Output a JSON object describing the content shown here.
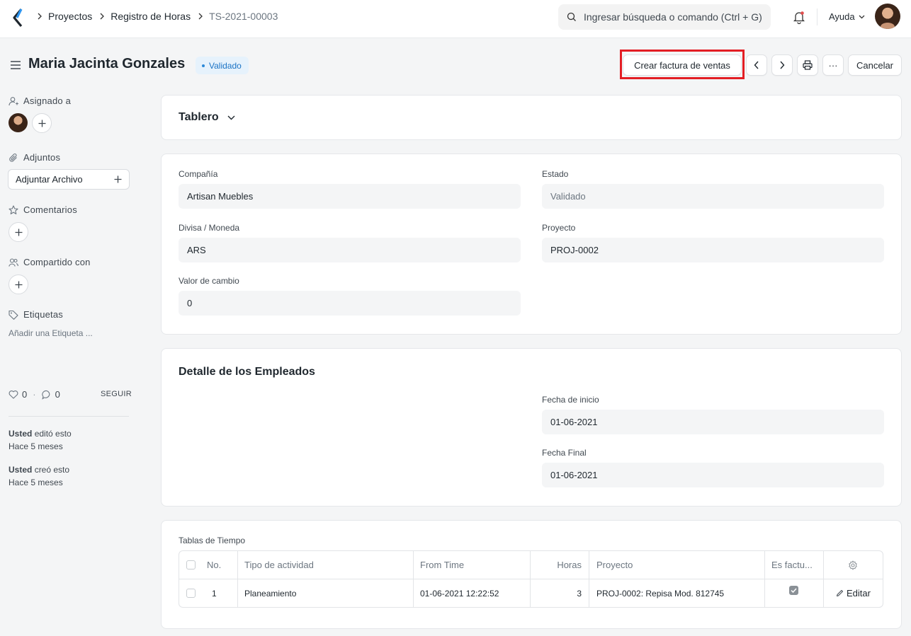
{
  "navbar": {
    "breadcrumbs": [
      "Proyectos",
      "Registro de Horas",
      "TS-2021-00003"
    ],
    "search_placeholder": "Ingresar búsqueda o comando (Ctrl + G)",
    "help_label": "Ayuda"
  },
  "header": {
    "title": "Maria Jacinta Gonzales",
    "status": "Validado",
    "create_invoice_label": "Crear factura de ventas",
    "more_label": "···",
    "cancel_label": "Cancelar"
  },
  "sidebar": {
    "assigned_label": "Asignado a",
    "attachments_label": "Adjuntos",
    "attach_file_label": "Adjuntar Archivo",
    "comments_label": "Comentarios",
    "shared_label": "Compartido con",
    "tags_label": "Etiquetas",
    "add_tag_label": "Añadir una Etiqueta ...",
    "likes_count": "0",
    "comments_count": "0",
    "follow_label": "SEGUIR",
    "activity": [
      {
        "user": "Usted",
        "action": "editó esto",
        "time": "Hace 5 meses"
      },
      {
        "user": "Usted",
        "action": "creó esto",
        "time": "Hace 5 meses"
      }
    ]
  },
  "dashboard": {
    "title": "Tablero"
  },
  "details": {
    "company_label": "Compañía",
    "company_value": "Artisan Muebles",
    "status_label": "Estado",
    "status_value": "Validado",
    "currency_label": "Divisa / Moneda",
    "currency_value": "ARS",
    "project_label": "Proyecto",
    "project_value": "PROJ-0002",
    "exchange_label": "Valor de cambio",
    "exchange_value": "0"
  },
  "employee": {
    "title": "Detalle de los Empleados",
    "start_label": "Fecha de inicio",
    "start_value": "01-06-2021",
    "end_label": "Fecha Final",
    "end_value": "01-06-2021"
  },
  "time_logs": {
    "label": "Tablas de Tiempo",
    "columns": [
      "No.",
      "Tipo de actividad",
      "From Time",
      "Horas",
      "Proyecto",
      "Es factu..."
    ],
    "rows": [
      {
        "no": "1",
        "activity": "Planeamiento",
        "from_time": "01-06-2021 12:22:52",
        "hours": "3",
        "project": "PROJ-0002: Repisa Mod. 812745",
        "billable": true,
        "edit_label": "Editar"
      }
    ]
  }
}
